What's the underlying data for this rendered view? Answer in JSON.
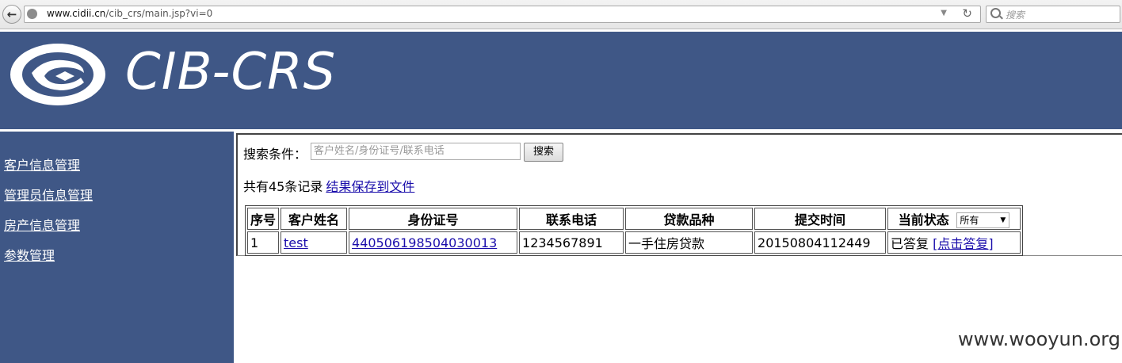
{
  "browser": {
    "url_host": "www.cidii.cn",
    "url_path": "/cib_crs/main.jsp?vi=0",
    "search_placeholder": "搜索"
  },
  "header": {
    "brand": "CIB-CRS"
  },
  "sidebar": {
    "items": [
      {
        "label": "客户信息管理"
      },
      {
        "label": "管理员信息管理"
      },
      {
        "label": "房产信息管理"
      },
      {
        "label": "参数管理"
      }
    ]
  },
  "search": {
    "label": "搜索条件：",
    "placeholder": "客户姓名/身份证号/联系电话",
    "button": "搜索"
  },
  "records": {
    "count_text": "共有45条记录",
    "save_link": "结果保存到文件"
  },
  "table": {
    "headers": [
      "序号",
      "客户姓名",
      "身份证号",
      "联系电话",
      "贷款品种",
      "提交时间",
      "当前状态"
    ],
    "status_filter": "所有",
    "rows": [
      {
        "index": "1",
        "name": "test",
        "id_number": "440506198504030013",
        "phone": "1234567891",
        "loan_type": "一手住房贷款",
        "submit_time": "20150804112449",
        "status": "已答复",
        "action": "[点击答复]"
      }
    ]
  },
  "watermark": "www.wooyun.org"
}
